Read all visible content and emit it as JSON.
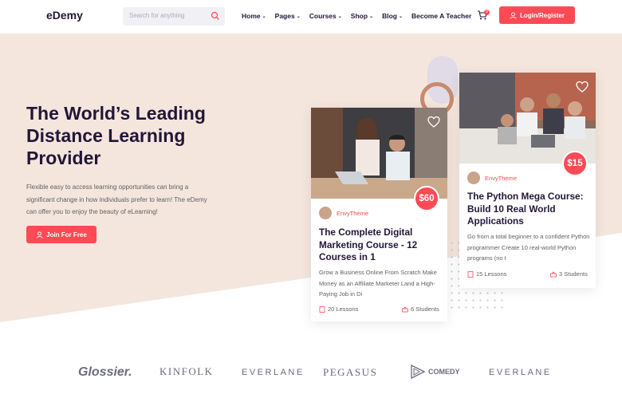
{
  "header": {
    "logo": "eDemy",
    "search_placeholder": "Search for anything",
    "nav": [
      "Home",
      "Pages",
      "Courses",
      "Shop",
      "Blog",
      "Become A Teacher"
    ],
    "cart_count": "0",
    "login_label": "Login/Register"
  },
  "hero": {
    "title": "The World’s Leading Distance Learning Provider",
    "description": "Flexible easy to access learning opportunities can bring a significant change in how individuals prefer to learn! The eDemy can offer you to enjoy the beauty of eLearning!",
    "cta_label": "Join For Free"
  },
  "cards": [
    {
      "price": "$60",
      "author": "EnvyTheme",
      "title": "The Complete Digital Marketing Course - 12 Courses in 1",
      "description": "Grow a Business Online From Scratch Make Money as an Affiliate Marketer Land a High-Paying Job in Di",
      "lessons": "20 Lessons",
      "students": "6 Students"
    },
    {
      "price": "$15",
      "author": "EnvyTheme",
      "title": "The Python Mega Course: Build 10 Real World Applications",
      "description": "Go from a total beginner to a confident Python programmer Create 10 real-world Python programs (no t",
      "lessons": "15 Lessons",
      "students": "3 Students"
    }
  ],
  "partners": [
    "Glossier.",
    "KINFOLK",
    "EVERLANE",
    "PEGASUS",
    "COMEDY",
    "EVERLANE"
  ],
  "colors": {
    "accent": "#fe4a55",
    "heading": "#221638",
    "hero_bg": "#f5e6dd"
  }
}
